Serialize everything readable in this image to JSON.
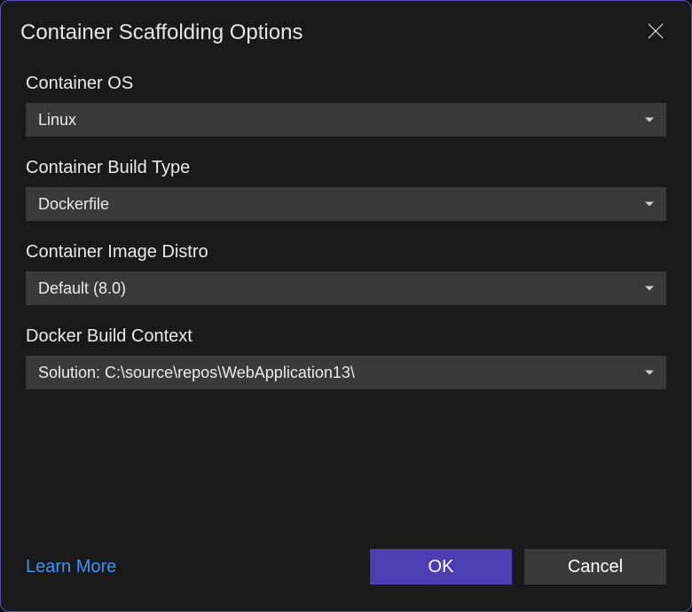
{
  "dialog": {
    "title": "Container Scaffolding Options"
  },
  "fields": {
    "container_os": {
      "label": "Container OS",
      "value": "Linux"
    },
    "build_type": {
      "label": "Container Build Type",
      "value": "Dockerfile"
    },
    "image_distro": {
      "label": "Container Image Distro",
      "value": "Default (8.0)"
    },
    "build_context": {
      "label": "Docker Build Context",
      "value": "Solution: C:\\source\\repos\\WebApplication13\\"
    }
  },
  "footer": {
    "learn_more": "Learn More",
    "ok": "OK",
    "cancel": "Cancel"
  }
}
